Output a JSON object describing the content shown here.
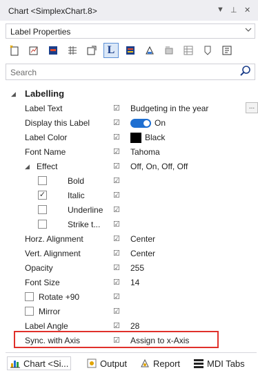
{
  "window": {
    "title": "Chart <SimplexChart.8>",
    "dropdown_glyph": "▼",
    "pin_glyph": "⊥",
    "close_glyph": "✕"
  },
  "selector": {
    "value": "Label Properties"
  },
  "toolbar": {
    "icons": [
      "new-icon",
      "properties-icon",
      "chart-icon",
      "grid-icon",
      "settings-icon",
      "label-icon",
      "legend-icon",
      "paint-icon",
      "data-icon",
      "table-icon",
      "help-icon",
      "layout-icon"
    ],
    "label_button_text": "L"
  },
  "search": {
    "placeholder": "Search"
  },
  "properties": {
    "category": "Labelling",
    "label_text": {
      "name": "Label Text",
      "value": "Budgeting in the year",
      "ellipsis": "..."
    },
    "display_label": {
      "name": "Display this Label",
      "value": "On"
    },
    "label_color": {
      "name": "Label Color",
      "value": "Black",
      "color": "#000000"
    },
    "font_name": {
      "name": "Font Name",
      "value": "Tahoma"
    },
    "effect": {
      "name": "Effect",
      "value": "Off, On, Off, Off"
    },
    "bold": {
      "name": "Bold",
      "checked": false
    },
    "italic": {
      "name": "Italic",
      "checked": true
    },
    "underline": {
      "name": "Underline",
      "checked": false
    },
    "strike": {
      "name": "Strike t...",
      "checked": false
    },
    "horz_align": {
      "name": "Horz. Alignment",
      "value": "Center"
    },
    "vert_align": {
      "name": "Vert. Alignment",
      "value": "Center"
    },
    "opacity": {
      "name": "Opacity",
      "value": "255"
    },
    "font_size": {
      "name": "Font Size",
      "value": "14"
    },
    "rotate": {
      "name": "Rotate +90",
      "checked": false
    },
    "mirror": {
      "name": "Mirror",
      "checked": false
    },
    "label_angle": {
      "name": "Label Angle",
      "value": "28"
    },
    "sync_axis": {
      "name": "Sync. with Axis",
      "value": "Assign to x-Axis"
    }
  },
  "bottom_tabs": [
    {
      "label": "Chart <Si...",
      "icon": "chart-icon"
    },
    {
      "label": "Output",
      "icon": "output-icon"
    },
    {
      "label": "Report",
      "icon": "report-icon"
    },
    {
      "label": "MDI Tabs",
      "icon": "mdi-tabs-icon"
    }
  ],
  "colors": {
    "accent": "#1f6fd1",
    "highlight": "#e0302a"
  }
}
